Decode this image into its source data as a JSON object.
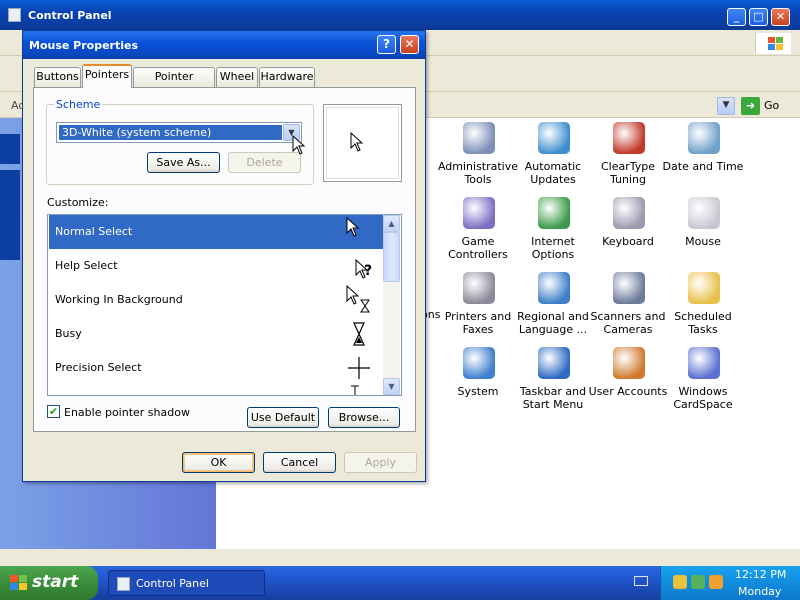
{
  "control_panel": {
    "title": "Control Panel",
    "address_label": "Ad",
    "go_label": "Go",
    "items": [
      {
        "name": "cp-item-administrative-tools",
        "label": "Administrative Tools",
        "color": "#7b8fb8"
      },
      {
        "name": "cp-item-automatic-updates",
        "label": "Automatic Updates",
        "color": "#3e8fd0"
      },
      {
        "name": "cp-item-cleartype-tuning",
        "label": "ClearType Tuning",
        "color": "#c23a2a"
      },
      {
        "name": "cp-item-date-and-time",
        "label": "Date and Time",
        "color": "#6fa0c8"
      },
      {
        "name": "cp-item-game-controllers",
        "label": "Game Controllers",
        "color": "#7d6ec4"
      },
      {
        "name": "cp-item-internet-options",
        "label": "Internet Options",
        "color": "#3c9b4a"
      },
      {
        "name": "cp-item-keyboard",
        "label": "Keyboard",
        "color": "#9a9ab0"
      },
      {
        "name": "cp-item-mouse",
        "label": "Mouse",
        "color": "#c8c8d2"
      },
      {
        "name": "cp-item-printers-and-faxes",
        "label": "Printers and Faxes",
        "color": "#8a8a9a"
      },
      {
        "name": "cp-item-regional-and-language",
        "label": "Regional and Language ...",
        "color": "#3d7fc6"
      },
      {
        "name": "cp-item-scanners-and-cameras",
        "label": "Scanners and Cameras",
        "color": "#6b7b9a"
      },
      {
        "name": "cp-item-scheduled-tasks",
        "label": "Scheduled Tasks",
        "color": "#e8c14a"
      },
      {
        "name": "cp-item-system",
        "label": "System",
        "color": "#3f7fd0"
      },
      {
        "name": "cp-item-taskbar-and-start-menu",
        "label": "Taskbar and Start Menu",
        "color": "#2e6bc4"
      },
      {
        "name": "cp-item-user-accounts",
        "label": "User Accounts",
        "color": "#d07a2e"
      },
      {
        "name": "cp-item-windows-cardspace",
        "label": "Windows CardSpace",
        "color": "#5a6fd0"
      }
    ],
    "partial_label": "ons"
  },
  "dialog": {
    "title": "Mouse Properties",
    "help_label": "?",
    "close_label": "✕",
    "tabs": [
      "Buttons",
      "Pointers",
      "Pointer Options",
      "Wheel",
      "Hardware"
    ],
    "active_tab": "Pointers",
    "scheme": {
      "legend": "Scheme",
      "value": "3D-White (system scheme)",
      "save_as_label": "Save As...",
      "delete_label": "Delete"
    },
    "customize_label": "Customize:",
    "cursors": [
      {
        "label": "Normal Select",
        "icon": "arrow-cursor-icon"
      },
      {
        "label": "Help Select",
        "icon": "help-cursor-icon"
      },
      {
        "label": "Working In Background",
        "icon": "working-cursor-icon"
      },
      {
        "label": "Busy",
        "icon": "hourglass-cursor-icon"
      },
      {
        "label": "Precision Select",
        "icon": "crosshair-cursor-icon"
      }
    ],
    "selected_cursor": "Normal Select",
    "shadow_checkbox_label": "Enable pointer shadow",
    "shadow_checked": true,
    "use_default_label": "Use Default",
    "browse_label": "Browse...",
    "ok_label": "OK",
    "cancel_label": "Cancel",
    "apply_label": "Apply"
  },
  "taskbar": {
    "start_label": "start",
    "task_label": "Control Panel",
    "time": "12:12 PM",
    "day": "Monday"
  },
  "colors": {
    "selection": "#316ac5",
    "title_blue": "#0a53d9",
    "start_green": "#3c8f3c",
    "tab_highlight": "#e68b2c"
  }
}
